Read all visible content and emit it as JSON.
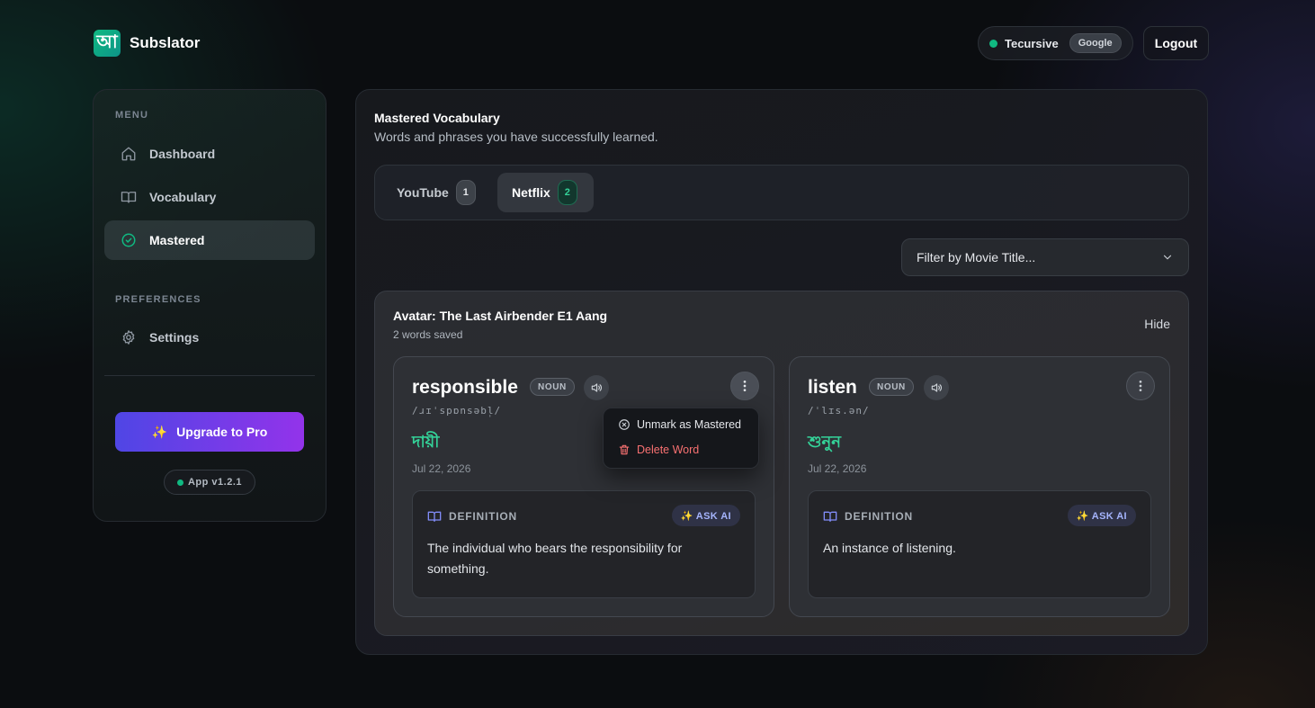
{
  "app": {
    "name": "Subslator",
    "logo_glyph": "আ"
  },
  "header": {
    "user_name": "Tecursive",
    "auth_provider": "Google",
    "logout_label": "Logout"
  },
  "sidebar": {
    "menu_heading": "MENU",
    "items": [
      {
        "label": "Dashboard",
        "icon": "home-icon"
      },
      {
        "label": "Vocabulary",
        "icon": "book-icon"
      },
      {
        "label": "Mastered",
        "icon": "check-circle-icon",
        "active": true
      }
    ],
    "preferences_heading": "PREFERENCES",
    "settings_label": "Settings",
    "upgrade_label": "Upgrade to Pro",
    "upgrade_emoji": "✨",
    "version": "App v1.2.1"
  },
  "main": {
    "title": "Mastered Vocabulary",
    "subtitle": "Words and phrases you have successfully learned.",
    "tabs": [
      {
        "label": "YouTube",
        "count": "1"
      },
      {
        "label": "Netflix",
        "count": "2",
        "active": true
      }
    ],
    "filter_placeholder": "Filter by Movie Title...",
    "group": {
      "title": "Avatar: The Last Airbender E1 Aang",
      "subtitle": "2 words saved",
      "hide_label": "Hide",
      "cards": [
        {
          "word": "responsible",
          "pos": "NOUN",
          "phonetic": "/ɹɪˈspɒnsəbl̩/",
          "translation": "দায়ী",
          "date": "Jul 22, 2026",
          "definition_label": "DEFINITION",
          "ask_ai_label": "✨ ASK AI",
          "definition": "The individual who bears the responsibility for something."
        },
        {
          "word": "listen",
          "pos": "NOUN",
          "phonetic": "/ˈlɪs.ən/",
          "translation": "শুনুন",
          "date": "Jul 22, 2026",
          "definition_label": "DEFINITION",
          "ask_ai_label": "✨ ASK AI",
          "definition": "An instance of listening."
        }
      ]
    },
    "context_menu": {
      "unmark_label": "Unmark as Mastered",
      "delete_label": "Delete Word"
    }
  },
  "colors": {
    "accent_green": "#10b981",
    "translation_green": "#34d399",
    "upgrade_gradient_start": "#4f46e5",
    "upgrade_gradient_end": "#9333ea",
    "danger": "#f87171"
  }
}
